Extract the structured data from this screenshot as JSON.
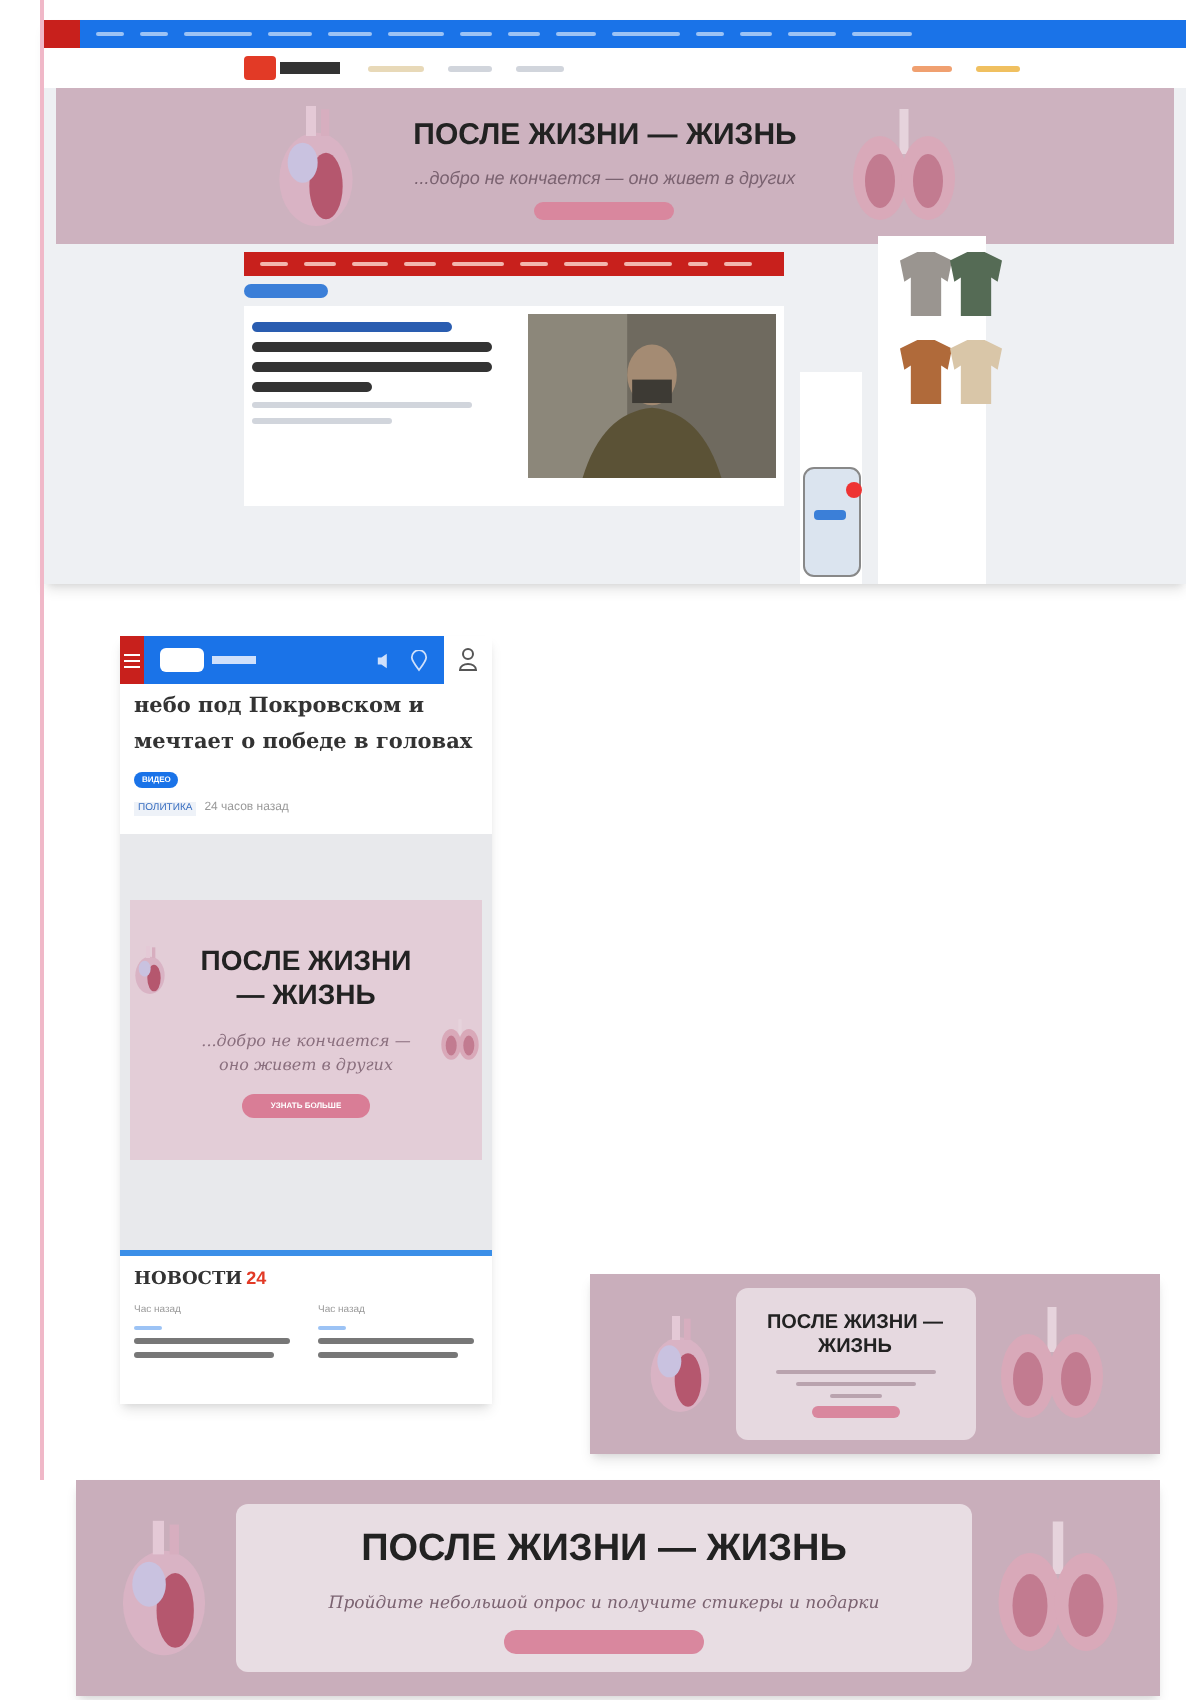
{
  "desktop": {
    "banner": {
      "title": "ПОСЛЕ ЖИЗНИ — ЖИЗНЬ",
      "subtitle": "...добро не кончается — оно живет в других"
    }
  },
  "mobile": {
    "headline_lines": [
      "небо под Покровском и",
      "мечтает о победе в головах"
    ],
    "tag": "ВИДЕО",
    "rubric": "ПОЛИТИКА",
    "time": "24 часов назад",
    "banner": {
      "title": "ПОСЛЕ ЖИЗНИ — ЖИЗНЬ",
      "subtitle": "...добро не кончается — оно живет в других",
      "button": "УЗНАТЬ БОЛЬШЕ"
    },
    "news": {
      "title": "НОВОСТИ",
      "count": "24",
      "items": [
        {
          "time": "Час назад"
        },
        {
          "time": "Час назад"
        }
      ]
    }
  },
  "small_banner": {
    "title": "ПОСЛЕ ЖИЗНИ — ЖИЗНЬ"
  },
  "large_banner": {
    "title": "ПОСЛЕ ЖИЗНИ — ЖИЗНЬ",
    "subtitle": "Пройдите небольшой опрос и получите стикеры и подарки"
  }
}
